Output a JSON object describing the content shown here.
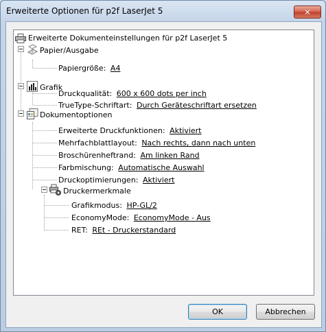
{
  "window": {
    "title": "Erweiterte Optionen für p2f LaserJet 5"
  },
  "tree": {
    "root_label": "Erweiterte Dokumenteinstellungen für p2f LaserJet 5",
    "paper": {
      "label": "Papier/Ausgabe",
      "size_label": "Papiergröße:",
      "size_value": "A4"
    },
    "graphic": {
      "label": "Grafik",
      "quality_label": "Druckqualität:",
      "quality_value": "600 x 600 dots per inch",
      "truetype_label": "TrueType-Schriftart:",
      "truetype_value": "Durch Geräteschriftart ersetzen"
    },
    "docopts": {
      "label": "Dokumentoptionen",
      "advanced_label": "Erweiterte Druckfunktionen:",
      "advanced_value": "Aktiviert",
      "multipage_label": "Mehrfachblattlayout:",
      "multipage_value": "Nach rechts, dann nach unten",
      "booklet_label": "Broschürenheftrand:",
      "booklet_value": "Am linken Rand",
      "halftone_label": "Farbmischung:",
      "halftone_value": "Automatische Auswahl",
      "optimize_label": "Druckoptimierungen:",
      "optimize_value": "Aktiviert",
      "features": {
        "label": "Druckermerkmale",
        "graphics_mode_label": "Grafikmodus:",
        "graphics_mode_value": "HP-GL/2",
        "economy_label": "EconomyMode:",
        "economy_value": "EconomyMode - Aus",
        "ret_label": "RET:",
        "ret_value": "REt - Druckerstandard"
      }
    }
  },
  "buttons": {
    "ok": "OK",
    "cancel": "Abbrechen"
  },
  "icons": {
    "close": "close-icon",
    "printer": "printer-icon",
    "paper": "paper-icon",
    "graphic": "chart-icon",
    "document": "document-options-icon",
    "features": "printer-features-icon"
  }
}
